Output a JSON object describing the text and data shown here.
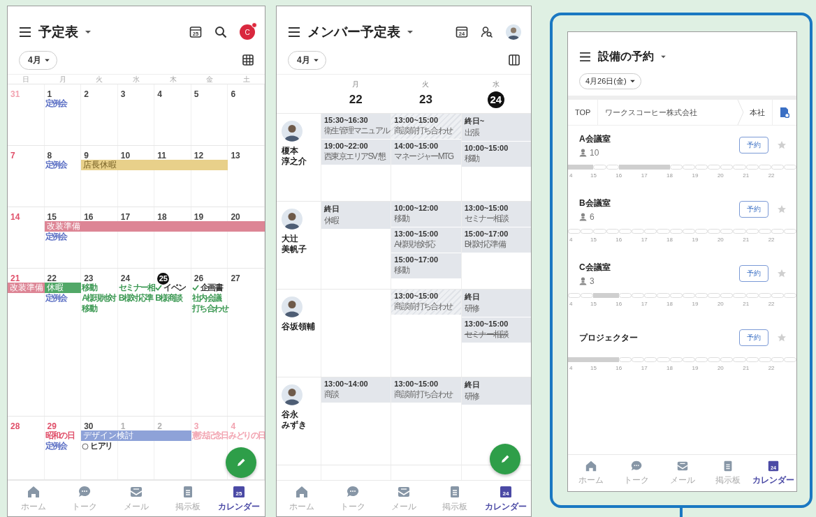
{
  "calendar": {
    "title": "予定表",
    "today_icon": "25",
    "avatar_initial": "C",
    "has_notification": true,
    "month": "4月",
    "weekdays": [
      "日",
      "月",
      "火",
      "水",
      "木",
      "金",
      "土"
    ],
    "weeks": [
      {
        "days": [
          {
            "number": "31",
            "kind": "outside-holiday"
          },
          {
            "number": "1",
            "kind": "normal",
            "events": [
              {
                "text": "定例会",
                "color": "#5b6fc4",
                "kind": "plain"
              }
            ]
          },
          {
            "number": "2",
            "kind": "normal"
          },
          {
            "number": "3",
            "kind": "normal"
          },
          {
            "number": "4",
            "kind": "normal"
          },
          {
            "number": "5",
            "kind": "normal"
          },
          {
            "number": "6",
            "kind": "normal"
          }
        ]
      },
      {
        "days": [
          {
            "number": "7",
            "kind": "holiday"
          },
          {
            "number": "8",
            "kind": "normal",
            "events": [
              {
                "text": "定例会",
                "color": "#5b6fc4",
                "kind": "plain"
              }
            ]
          },
          {
            "number": "9",
            "kind": "normal",
            "bar": {
              "label": "店長休暇",
              "color": "#e8d08a"
            }
          },
          {
            "number": "10",
            "kind": "normal",
            "continues": true
          },
          {
            "number": "11",
            "kind": "normal",
            "continues": true
          },
          {
            "number": "12",
            "kind": "normal",
            "continues": true
          },
          {
            "number": "13",
            "kind": "normal"
          }
        ]
      },
      {
        "days": [
          {
            "number": "14",
            "kind": "holiday"
          },
          {
            "number": "15",
            "kind": "normal",
            "bar": {
              "label": "改装準備",
              "color": "#dd8595"
            },
            "events": [
              {
                "text": "定例会",
                "color": "#5b6fc4",
                "kind": "plain"
              }
            ]
          },
          {
            "number": "16",
            "kind": "normal",
            "continues": true
          },
          {
            "number": "17",
            "kind": "normal",
            "continues": true
          },
          {
            "number": "18",
            "kind": "normal",
            "continues": true
          },
          {
            "number": "19",
            "kind": "normal",
            "continues": true
          },
          {
            "number": "20",
            "kind": "normal",
            "continues": true
          }
        ]
      },
      {
        "days": [
          {
            "number": "21",
            "kind": "holiday",
            "bar": {
              "label": "改装準備",
              "color": "#dd8595"
            }
          },
          {
            "number": "22",
            "kind": "normal",
            "bar": {
              "label": "休暇",
              "color": "#52a868"
            },
            "events": [
              {
                "text": "定例会",
                "color": "#5b6fc4",
                "kind": "plain"
              }
            ]
          },
          {
            "number": "23",
            "kind": "normal",
            "events": [
              {
                "text": "移動",
                "color": "#3e9a55",
                "kind": "plain"
              },
              {
                "text": "A様現地対",
                "color": "#3e9a55",
                "kind": "plain"
              },
              {
                "text": "移動",
                "color": "#3e9a55",
                "kind": "plain"
              }
            ]
          },
          {
            "number": "24",
            "kind": "normal",
            "events": [
              {
                "text": "セミナー相",
                "color": "#3e9a55",
                "kind": "plain"
              },
              {
                "text": "B様対応準",
                "color": "#3e9a55",
                "kind": "plain"
              }
            ]
          },
          {
            "number": "25",
            "kind": "today",
            "events": [
              {
                "text": "イベン",
                "color": "#333333",
                "kind": "check"
              },
              {
                "text": "B様商談",
                "color": "#3e9a55",
                "kind": "plain"
              }
            ]
          },
          {
            "number": "26",
            "kind": "normal",
            "events": [
              {
                "text": "企画書",
                "color": "#333333",
                "kind": "check"
              },
              {
                "text": "社内会議",
                "color": "#3e9a55",
                "kind": "plain"
              },
              {
                "text": "打ち合わせ",
                "color": "#3e9a55",
                "kind": "plain"
              }
            ]
          },
          {
            "number": "27",
            "kind": "normal"
          }
        ]
      },
      {
        "days": [
          {
            "number": "28",
            "kind": "holiday"
          },
          {
            "number": "29",
            "kind": "holiday",
            "events": [
              {
                "text": "昭和の日",
                "color": "#e0506a",
                "kind": "plain"
              },
              {
                "text": "定例会",
                "color": "#5b6fc4",
                "kind": "plain"
              }
            ]
          },
          {
            "number": "30",
            "kind": "normal",
            "bar": {
              "label": "デザイン検討",
              "color": "#8ea2d8"
            },
            "events": [
              {
                "text": "ヒアリ",
                "color": "#333333",
                "kind": "circle"
              }
            ]
          },
          {
            "number": "1",
            "kind": "outside",
            "continues": true
          },
          {
            "number": "2",
            "kind": "outside",
            "continues": true
          },
          {
            "number": "3",
            "kind": "outside-holiday",
            "events": [
              {
                "text": "憲法記念日",
                "color": "#f2a3b0",
                "kind": "plain"
              }
            ]
          },
          {
            "number": "4",
            "kind": "outside-holiday",
            "events": [
              {
                "text": "みどりの日",
                "color": "#f2a3b0",
                "kind": "plain"
              }
            ]
          }
        ]
      }
    ],
    "nav": [
      {
        "label": "ホーム",
        "kind": "home",
        "selected": false
      },
      {
        "label": "トーク",
        "kind": "talk",
        "selected": false
      },
      {
        "label": "メール",
        "kind": "mail",
        "selected": false
      },
      {
        "label": "掲示板",
        "kind": "board",
        "selected": false
      },
      {
        "label": "カレンダー",
        "kind": "calendar",
        "icon_text": "25",
        "selected": true
      }
    ]
  },
  "members": {
    "title": "メンバー予定表",
    "today_icon": "24",
    "month": "4月",
    "days": [
      {
        "weekday": "月",
        "date": "22",
        "today": false
      },
      {
        "weekday": "火",
        "date": "23",
        "today": false
      },
      {
        "weekday": "水",
        "date": "24",
        "today": true
      }
    ],
    "rows": [
      {
        "name_lines": [
          "榎本",
          "淳之介"
        ],
        "cells": [
          {
            "events": [
              {
                "time": "15:30~16:30",
                "title": "衛生管理マニュアル",
                "kind": "plain"
              },
              {
                "time": "19:00~22:00",
                "title": "西東京エリアSV 懇",
                "kind": "plain"
              }
            ]
          },
          {
            "events": [
              {
                "time": "13:00~15:00",
                "title": "商談前打ち合わせ",
                "kind": "hatched"
              },
              {
                "time": "14:00~15:00",
                "title": "マネージャーMTG",
                "kind": "plain"
              }
            ]
          },
          {
            "events": [
              {
                "time": "終日~",
                "title": "出張",
                "kind": "plain"
              },
              {
                "time": "10:00~15:00",
                "title": "移動",
                "kind": "plain"
              }
            ]
          }
        ]
      },
      {
        "name_lines": [
          "大辻",
          "美帆子"
        ],
        "cells": [
          {
            "events": [
              {
                "time": "終日",
                "title": "休暇",
                "kind": "plain"
              }
            ]
          },
          {
            "events": [
              {
                "time": "10:00~12:00",
                "title": "移動",
                "kind": "plain"
              },
              {
                "time": "13:00~15:00",
                "title": "A様現地対応",
                "kind": "plain"
              },
              {
                "time": "15:00~17:00",
                "title": "移動",
                "kind": "plain"
              }
            ]
          },
          {
            "events": [
              {
                "time": "13:00~15:00",
                "title": "セミナー相談",
                "kind": "plain"
              },
              {
                "time": "15:00~17:00",
                "title": "B様対応準備",
                "kind": "plain"
              }
            ]
          }
        ]
      },
      {
        "name_lines": [
          "谷坂領輔"
        ],
        "cells": [
          {},
          {
            "events": [
              {
                "time": "13:00~15:00",
                "title": "商談前打ち合わせ",
                "kind": "hatched"
              }
            ]
          },
          {
            "events": [
              {
                "time": "終日",
                "title": "研修",
                "kind": "plain"
              },
              {
                "time": "13:00~15:00",
                "title": "セミナー相談",
                "kind": "struck"
              }
            ]
          }
        ]
      },
      {
        "name_lines": [
          "谷永",
          "みずき"
        ],
        "cells": [
          {
            "events": [
              {
                "time": "13:00~14:00",
                "title": "商談",
                "kind": "plain"
              }
            ]
          },
          {
            "events": [
              {
                "time": "13:00~15:00",
                "title": "商談前打ち合わせ",
                "kind": "plain"
              }
            ]
          },
          {
            "events": [
              {
                "time": "終日",
                "title": "研修",
                "kind": "plain"
              }
            ]
          }
        ]
      }
    ],
    "nav": [
      {
        "label": "ホーム",
        "kind": "home",
        "selected": false
      },
      {
        "label": "トーク",
        "kind": "talk",
        "selected": false
      },
      {
        "label": "メール",
        "kind": "mail",
        "selected": false
      },
      {
        "label": "掲示板",
        "kind": "board",
        "selected": false
      },
      {
        "label": "カレンダー",
        "kind": "calendar",
        "icon_text": "24",
        "selected": true
      }
    ]
  },
  "facilities": {
    "title": "設備の予約",
    "date": "4月26日(金)",
    "breadcrumb": [
      "TOP",
      "ワークスコーヒー株式会社",
      "本社"
    ],
    "items": [
      {
        "name": "A会議室",
        "capacity": "10",
        "button": "予約",
        "starred": false,
        "booked": [
          true,
          true,
          false,
          false,
          true,
          true,
          true,
          true,
          false,
          false,
          false,
          false,
          false,
          false,
          false,
          false,
          false,
          false
        ],
        "ticks": [
          "4",
          "15",
          "16",
          "17",
          "18",
          "19",
          "20",
          "21",
          "22"
        ]
      },
      {
        "name": "B会議室",
        "capacity": "6",
        "button": "予約",
        "starred": false,
        "booked": [
          false,
          false,
          false,
          false,
          false,
          false,
          false,
          false,
          false,
          false,
          false,
          false,
          false,
          false,
          false,
          false,
          false,
          false
        ],
        "ticks": [
          "4",
          "15",
          "16",
          "17",
          "18",
          "19",
          "20",
          "21",
          "22"
        ]
      },
      {
        "name": "C会議室",
        "capacity": "3",
        "button": "予約",
        "starred": false,
        "booked": [
          false,
          false,
          true,
          true,
          false,
          false,
          false,
          false,
          false,
          false,
          false,
          false,
          false,
          false,
          false,
          false,
          false,
          false
        ],
        "ticks": [
          "4",
          "15",
          "16",
          "17",
          "18",
          "19",
          "20",
          "21",
          "22"
        ]
      },
      {
        "name": "プロジェクター",
        "button": "予約",
        "starred": false,
        "booked": [
          true,
          true,
          true,
          true,
          false,
          false,
          false,
          false,
          false,
          false,
          false,
          false,
          false,
          false,
          false,
          false,
          false,
          false
        ],
        "ticks": [
          "4",
          "15",
          "16",
          "17",
          "18",
          "19",
          "20",
          "21",
          "22"
        ]
      }
    ],
    "nav": [
      {
        "label": "ホーム",
        "kind": "home",
        "selected": false
      },
      {
        "label": "トーク",
        "kind": "talk",
        "selected": false
      },
      {
        "label": "メール",
        "kind": "mail",
        "selected": false
      },
      {
        "label": "掲示板",
        "kind": "board",
        "selected": false
      },
      {
        "label": "カレンダー",
        "kind": "calendar",
        "icon_text": "24",
        "selected": true
      }
    ]
  }
}
